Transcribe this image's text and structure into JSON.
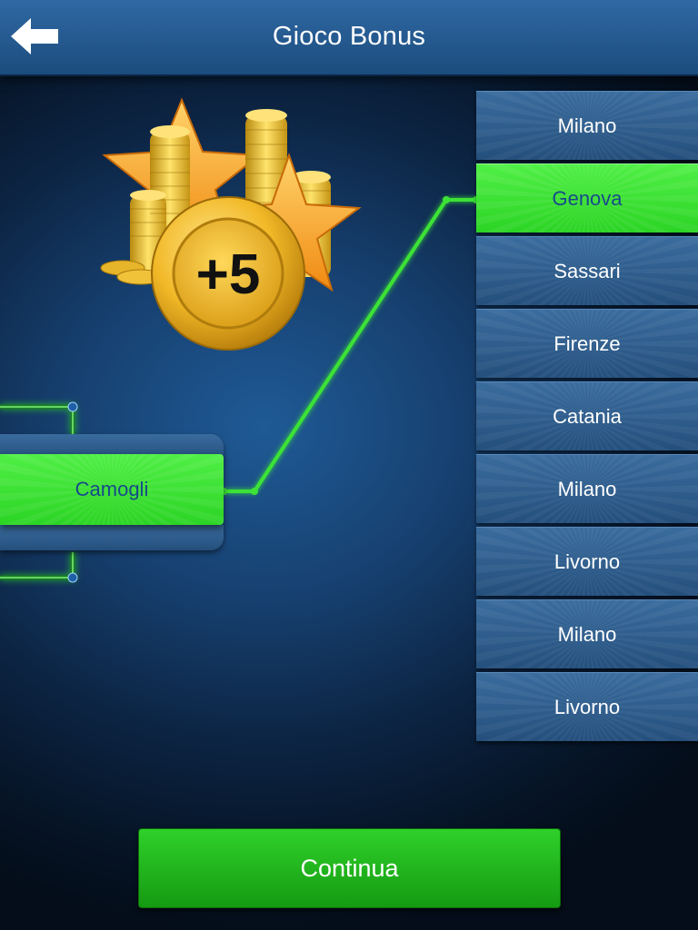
{
  "header": {
    "title": "Gioco Bonus",
    "back_icon": "arrow-left-icon"
  },
  "reward": {
    "label": "+5",
    "icon": "coin-stars-icon"
  },
  "source": {
    "label": "Camogli",
    "state": "selected"
  },
  "options": [
    {
      "label": "Milano",
      "selected": false
    },
    {
      "label": "Genova",
      "selected": true
    },
    {
      "label": "Sassari",
      "selected": false
    },
    {
      "label": "Firenze",
      "selected": false
    },
    {
      "label": "Catania",
      "selected": false
    },
    {
      "label": "Milano",
      "selected": false
    },
    {
      "label": "Livorno",
      "selected": false
    },
    {
      "label": "Milano",
      "selected": false
    },
    {
      "label": "Livorno",
      "selected": false
    }
  ],
  "continue_button": {
    "label": "Continua"
  },
  "colors": {
    "accent_green": "#3ce336",
    "selected_text": "#174a8a",
    "option_blue": "#2f5e8e",
    "header_blue": "#2a5f96"
  }
}
